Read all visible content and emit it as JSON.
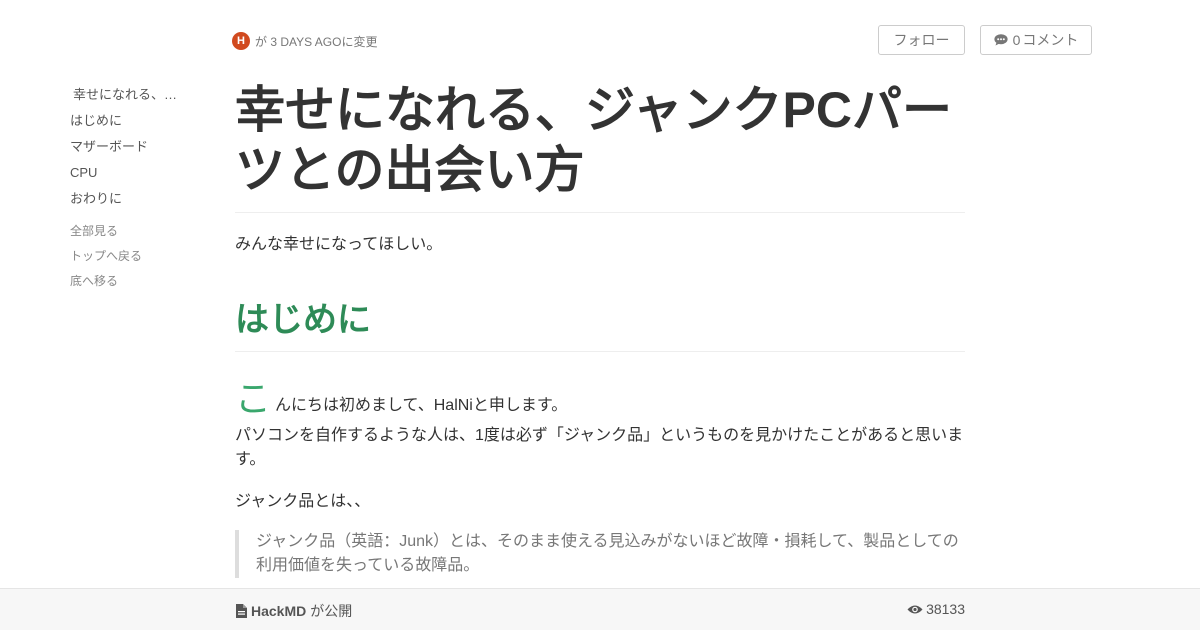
{
  "meta": {
    "avatar_letter": "H",
    "changed_text": "が 3 DAYS AGOに変更"
  },
  "buttons": {
    "follow": "フォロー",
    "comment_count": "0",
    "comment_label": "コメント"
  },
  "toc": {
    "items": [
      "幸せになれる、…",
      "はじめに",
      "マザーボード",
      "CPU",
      "おわりに"
    ],
    "links": [
      "全部見る",
      "トップへ戻る",
      "底へ移る"
    ]
  },
  "article": {
    "title": "幸せになれる、ジャンクPCパーツとの出会い方",
    "subtitle": "みんな幸せになってほしい。",
    "h2": "はじめに",
    "dropcap": "こ",
    "first_para_rest": "んにちは初めまして、HalNiと申します。",
    "para1": "パソコンを自作するような人は、1度は必ず「ジャンク品」というものを見かけたことがあると思います。",
    "para2": "ジャンク品とは、、",
    "quote": "ジャンク品（英語：Junk）とは、そのまま使える見込みがないほど故障・損耗して、製品としての利用価値を失っている故障品。"
  },
  "footer": {
    "brand": "HackMD",
    "published": "が公開",
    "views": "38133"
  },
  "colors": {
    "heading_green": "#2e8b57",
    "avatar": "#d14a1f"
  }
}
